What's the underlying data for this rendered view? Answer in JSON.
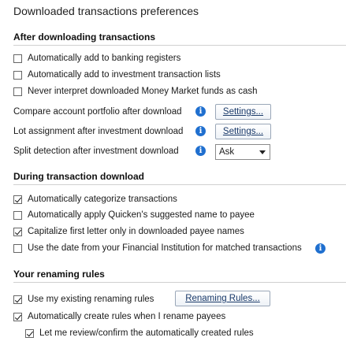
{
  "page": {
    "title": "Downloaded transactions preferences"
  },
  "after": {
    "heading": "After downloading transactions",
    "auto_banking": {
      "label": "Automatically add to banking registers",
      "checked": false
    },
    "auto_investment": {
      "label": "Automatically add to investment transaction lists",
      "checked": false
    },
    "never_money_market": {
      "label": "Never interpret downloaded Money Market funds as cash",
      "checked": false
    },
    "compare_portfolio": {
      "label": "Compare account portfolio after download",
      "button": "Settings..."
    },
    "lot_assignment": {
      "label": "Lot assignment after investment download",
      "button": "Settings..."
    },
    "split_detection": {
      "label": "Split detection after investment download",
      "value": "Ask"
    },
    "info_glyph": "i"
  },
  "during": {
    "heading": "During transaction download",
    "auto_categorize": {
      "label": "Automatically categorize transactions",
      "checked": true
    },
    "auto_apply_name": {
      "label": "Automatically apply Quicken's suggested name to payee",
      "checked": false
    },
    "capitalize_first": {
      "label": "Capitalize first letter only in downloaded payee names",
      "checked": true
    },
    "use_fi_date": {
      "label": "Use the date from your Financial Institution for matched transactions",
      "checked": false
    }
  },
  "renaming": {
    "heading": "Your renaming rules",
    "use_existing": {
      "label": "Use my existing renaming rules",
      "checked": true
    },
    "button": "Renaming Rules...",
    "auto_create": {
      "label": "Automatically create rules when I rename payees",
      "checked": true
    },
    "review_confirm": {
      "label": "Let me review/confirm the automatically created rules",
      "checked": true
    }
  },
  "icons": {
    "info": "info-icon",
    "checkbox": "checkbox",
    "dropdown": "chevron-down-icon"
  },
  "colors": {
    "info_blue": "#1f6fcf",
    "rule": "#d0d0d0"
  }
}
